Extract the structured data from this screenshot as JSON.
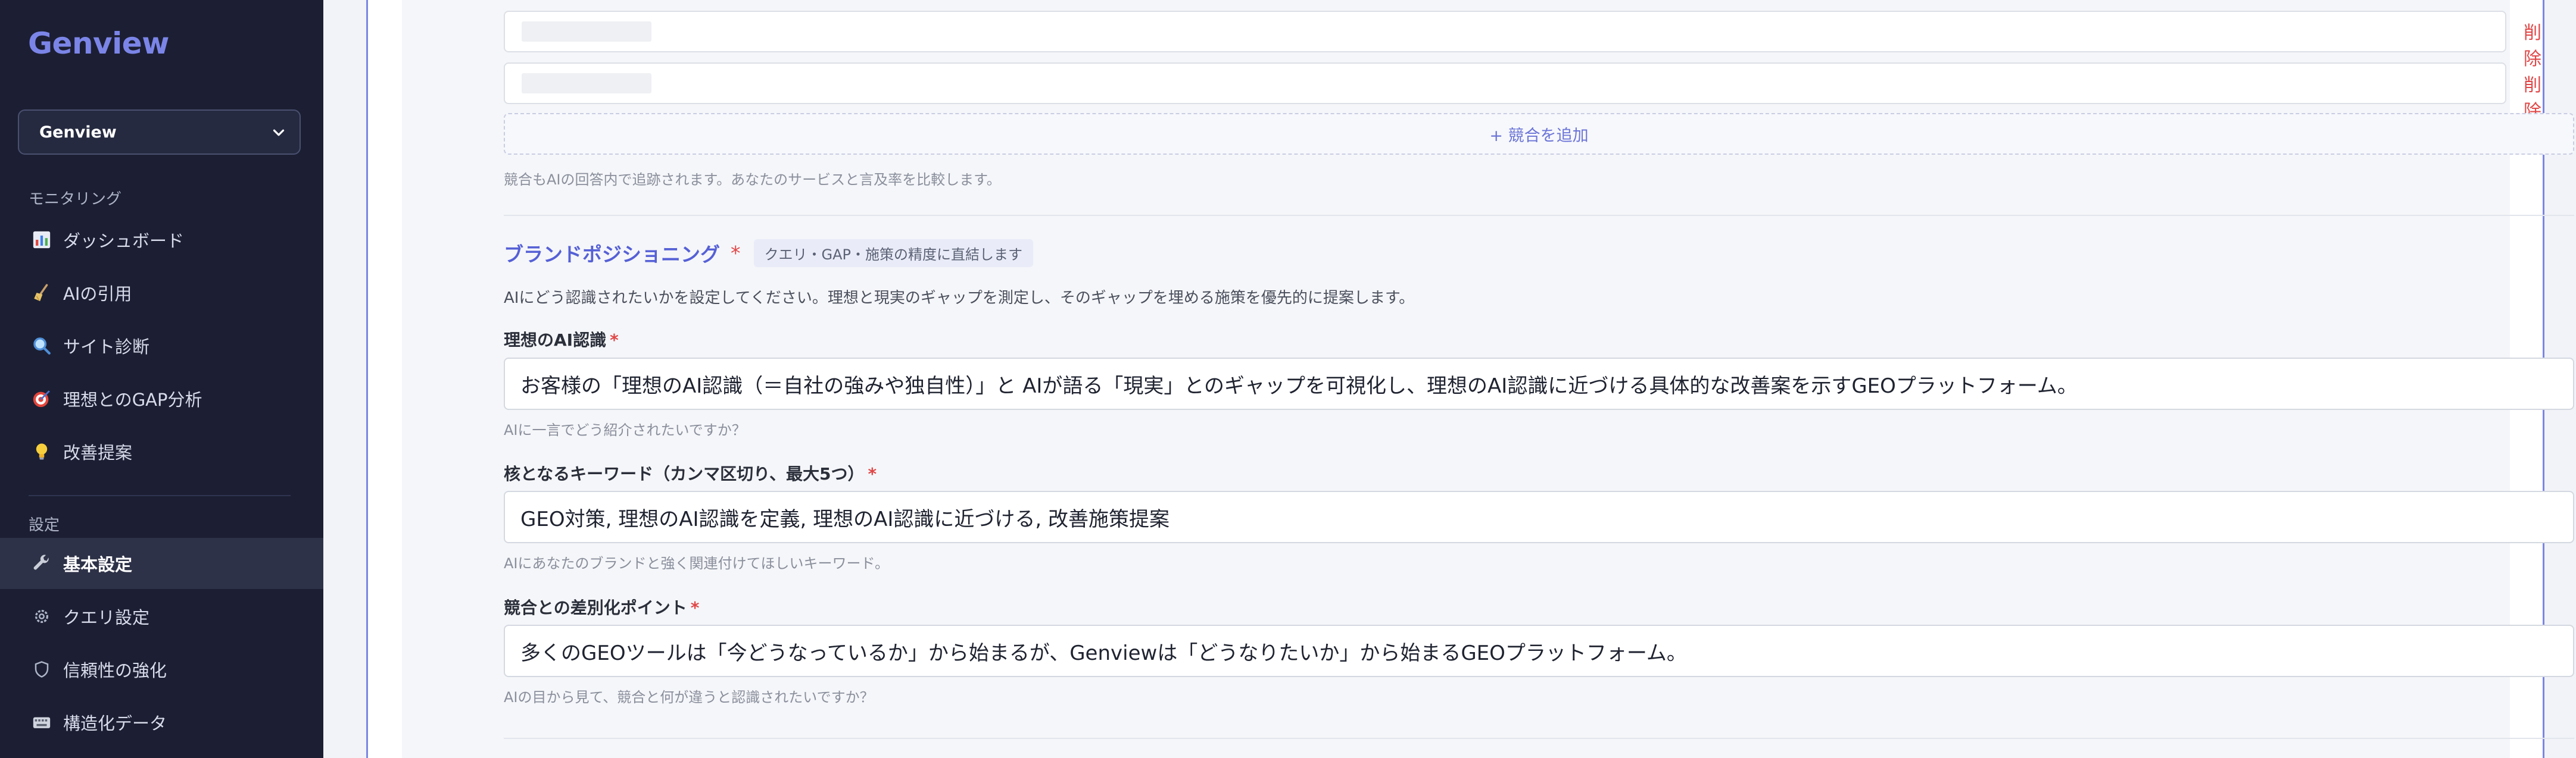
{
  "app": {
    "logo": "Genview"
  },
  "project_selector": {
    "value": "Genview"
  },
  "sidebar": {
    "monitoring_label": "モニタリング",
    "monitoring_items": [
      {
        "label": "ダッシュボード",
        "icon": "chart-icon"
      },
      {
        "label": "AIの引用",
        "icon": "broom-icon"
      },
      {
        "label": "サイト診断",
        "icon": "magnifier-icon"
      },
      {
        "label": "理想とのGAP分析",
        "icon": "target-icon"
      },
      {
        "label": "改善提案",
        "icon": "lightbulb-icon"
      }
    ],
    "settings_label": "設定",
    "settings_items": [
      {
        "label": "基本設定",
        "icon": "wrench-icon",
        "active": true
      },
      {
        "label": "クエリ設定",
        "icon": "gear-icon"
      },
      {
        "label": "信頼性の強化",
        "icon": "shield-icon"
      },
      {
        "label": "構造化データ",
        "icon": "keyboard-icon"
      }
    ]
  },
  "competitors": {
    "delete_label": "削除",
    "add_label": "+ 競合を追加",
    "hint": "競合もAIの回答内で追跡されます。あなたのサービスと言及率を比較します。"
  },
  "positioning": {
    "title": "ブランドポジショニング",
    "required_mark": "*",
    "badge": "クエリ・GAP・施策の精度に直結します",
    "description": "AIにどう認識されたいかを設定してください。理想と現実のギャップを測定し、そのギャップを埋める施策を優先的に提案します。",
    "ideal": {
      "label": "理想のAI認識",
      "value": "お客様の「理想のAI認識（＝自社の強みや独自性）」と AIが語る「現実」とのギャップを可視化し、理想のAI認識に近づける具体的な改善案を示すGEOプラットフォーム。",
      "hint": "AIに一言でどう紹介されたいですか？"
    },
    "keywords": {
      "label": "核となるキーワード（カンマ区切り、最大5つ）",
      "value": "GEO対策, 理想のAI認識を定義, 理想のAI認識に近づける, 改善施策提案",
      "hint": "AIにあなたのブランドと強く関連付けてほしいキーワード。"
    },
    "differentiation": {
      "label": "競合との差別化ポイント",
      "value": "多くのGEOツールは「今どうなっているか」から始まるが、Genviewは「どうなりたいか」から始まるGEOプラットフォーム。",
      "hint": "AIの目から見て、競合と何が違うと認識されたいですか？"
    }
  },
  "colors": {
    "sidebar_bg": "#1c1f33",
    "accent": "#5560d6",
    "danger": "#e04848"
  }
}
